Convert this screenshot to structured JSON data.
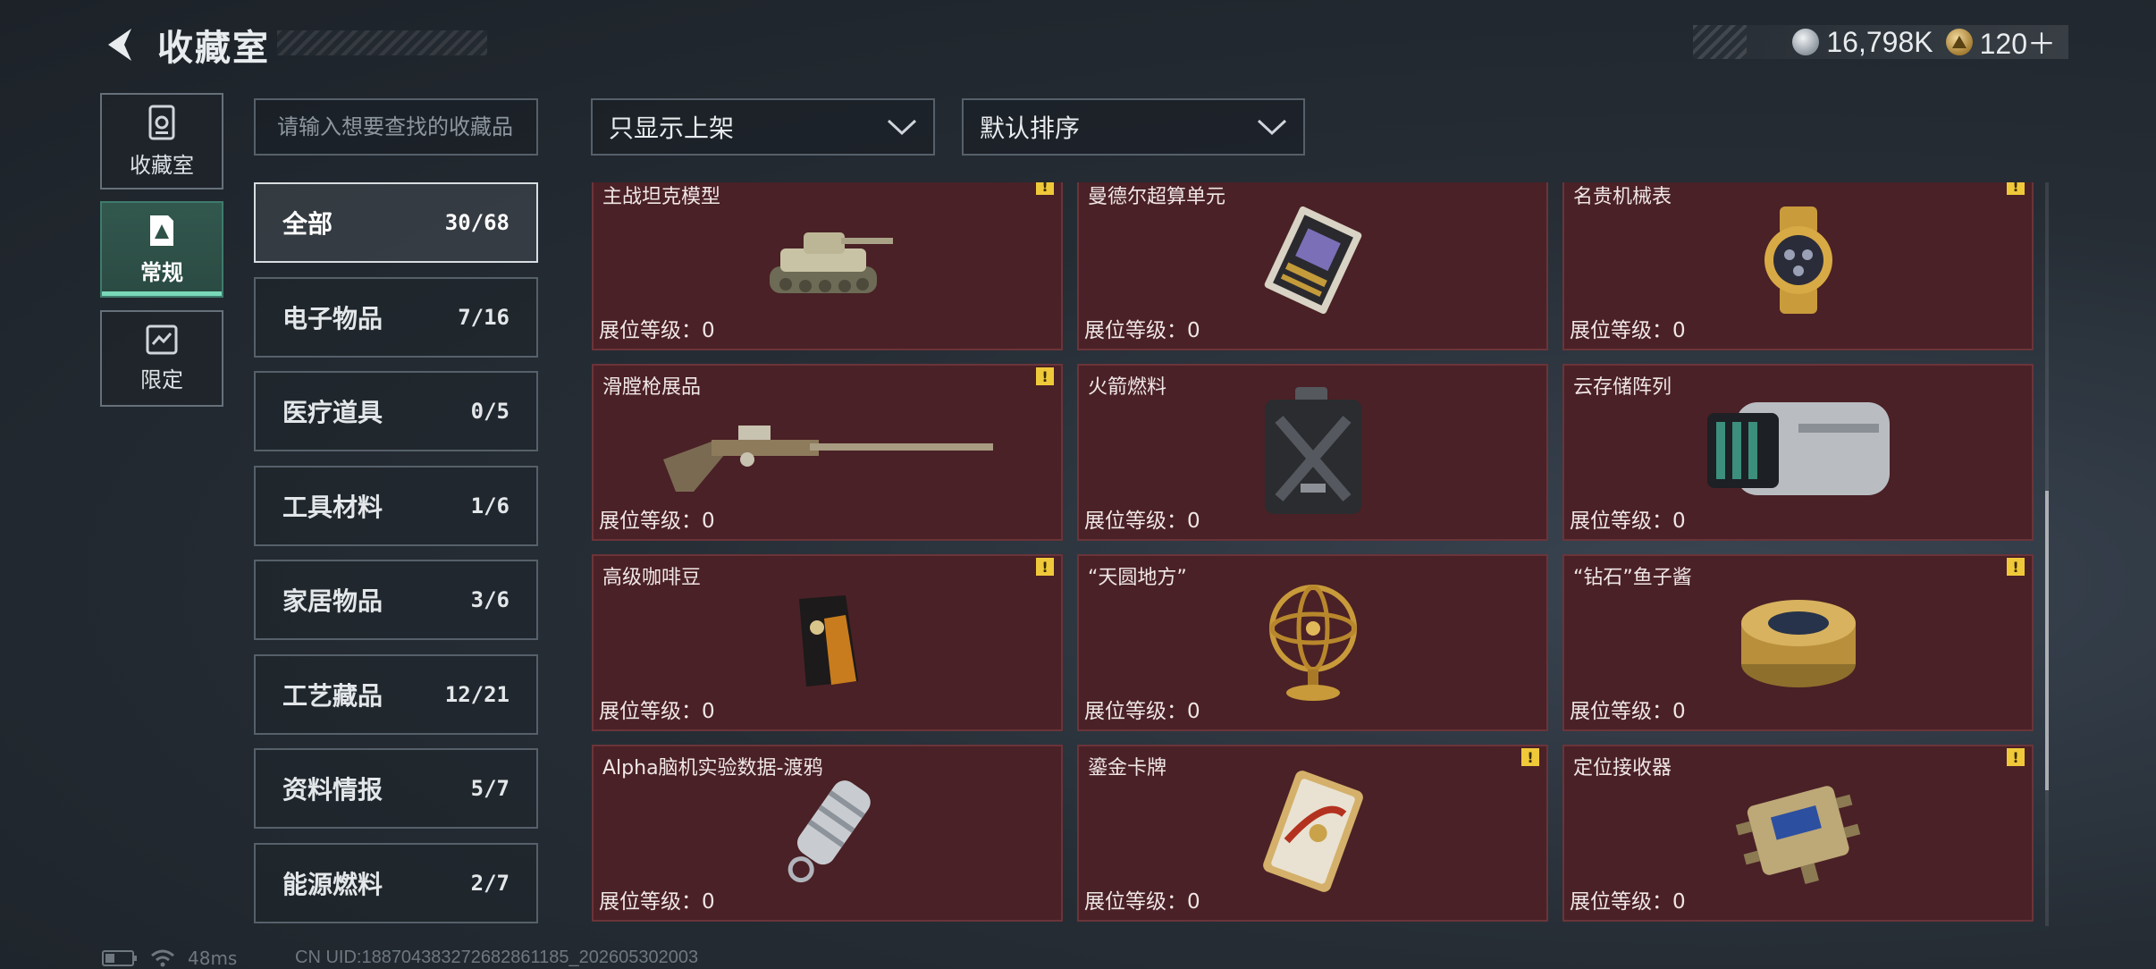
{
  "header": {
    "title": "收藏室",
    "currency": [
      {
        "icon": "silver-coin-icon",
        "value": "16,798K"
      },
      {
        "icon": "gold-coin-icon",
        "value": "120＋"
      }
    ]
  },
  "sidebar": [
    {
      "label": "收藏室",
      "icon": "collection-room-icon",
      "active": false
    },
    {
      "label": "常规",
      "icon": "regular-icon",
      "active": true
    },
    {
      "label": "限定",
      "icon": "limited-icon",
      "active": false
    }
  ],
  "search": {
    "placeholder": "请输入想要查找的收藏品"
  },
  "filters": {
    "display": "只显示上架",
    "sort": "默认排序"
  },
  "categories": [
    {
      "name": "全部",
      "count": "30/68",
      "active": true
    },
    {
      "name": "电子物品",
      "count": "7/16"
    },
    {
      "name": "医疗道具",
      "count": "0/5"
    },
    {
      "name": "工具材料",
      "count": "1/6"
    },
    {
      "name": "家居物品",
      "count": "3/6"
    },
    {
      "name": "工艺藏品",
      "count": "12/21"
    },
    {
      "name": "资料情报",
      "count": "5/7"
    },
    {
      "name": "能源燃料",
      "count": "2/7"
    }
  ],
  "items": [
    {
      "name": "主战坦克模型",
      "level": "展位等级：0",
      "warning": true,
      "icon": "tank-model-icon"
    },
    {
      "name": "曼德尔超算单元",
      "level": "展位等级：0",
      "warning": false,
      "icon": "supercomputer-unit-icon"
    },
    {
      "name": "名贵机械表",
      "level": "展位等级：0",
      "warning": true,
      "icon": "mechanical-watch-icon"
    },
    {
      "name": "滑膛枪展品",
      "level": "展位等级：0",
      "warning": true,
      "icon": "musket-icon"
    },
    {
      "name": "火箭燃料",
      "level": "展位等级：0",
      "warning": false,
      "icon": "fuel-canister-icon"
    },
    {
      "name": "云存储阵列",
      "level": "展位等级：0",
      "warning": false,
      "icon": "storage-array-icon"
    },
    {
      "name": "高级咖啡豆",
      "level": "展位等级：0",
      "warning": true,
      "icon": "coffee-bag-icon"
    },
    {
      "name": "“天圆地方”",
      "level": "展位等级：0",
      "warning": false,
      "icon": "armillary-sphere-icon"
    },
    {
      "name": "“钻石”鱼子酱",
      "level": "展位等级：0",
      "warning": true,
      "icon": "caviar-tin-icon"
    },
    {
      "name": "Alpha脑机实验数据-渡鸦",
      "level": "展位等级：0",
      "warning": false,
      "icon": "data-capsule-icon"
    },
    {
      "name": "鎏金卡牌",
      "level": "展位等级：0",
      "warning": true,
      "icon": "gilded-card-icon"
    },
    {
      "name": "定位接收器",
      "level": "展位等级：0",
      "warning": true,
      "icon": "locator-receiver-icon"
    }
  ],
  "status": {
    "ping": "48ms",
    "uid": "CN UID:18870438327268286118​5_202605302003"
  }
}
